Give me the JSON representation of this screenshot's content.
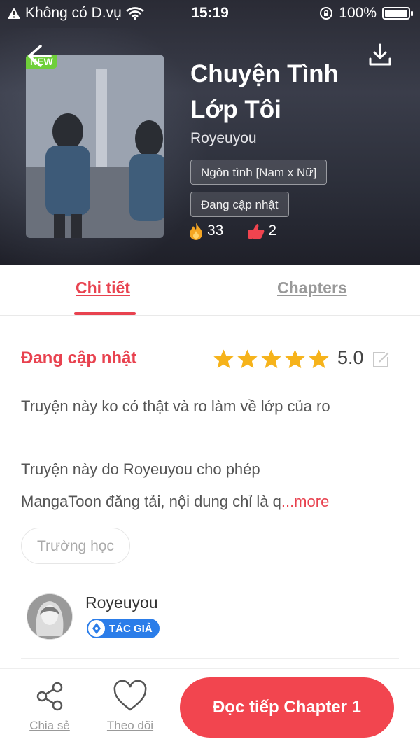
{
  "status_bar": {
    "carrier": "Không có D.vụ",
    "time": "15:19",
    "battery": "100%"
  },
  "header": {
    "badge": "NEW",
    "title_line1": "Chuyện Tình",
    "title_line2": "Lớp Tôi",
    "author": "Royeuyou",
    "tags": [
      "Ngôn tình [Nam x Nữ]",
      "Đang cập nhật"
    ],
    "hot_count": "33",
    "like_count": "2"
  },
  "tabs": {
    "details": "Chi tiết",
    "chapters": "Chapters"
  },
  "detail": {
    "status": "Đang cập nhật",
    "rating": "5.0",
    "stars": 5,
    "desc_line1": "Truyện này ko có thật và ro làm về lớp của ro",
    "desc_line2": "Truyện này do Royeuyou cho phép",
    "desc_line3": "MangaToon đăng tải, nội dung chỉ là q",
    "more": "...more",
    "genre_chip": "Trường học"
  },
  "author_block": {
    "name": "Royeuyou",
    "badge": "TÁC GIẢ"
  },
  "bottom": {
    "share": "Chia sẻ",
    "follow": "Theo dõi",
    "read": "Đọc tiếp Chapter 1"
  },
  "colors": {
    "accent": "#e8424f",
    "button": "#f2454f",
    "badge_blue": "#2b7de9",
    "new_green": "#6fcf3a"
  }
}
